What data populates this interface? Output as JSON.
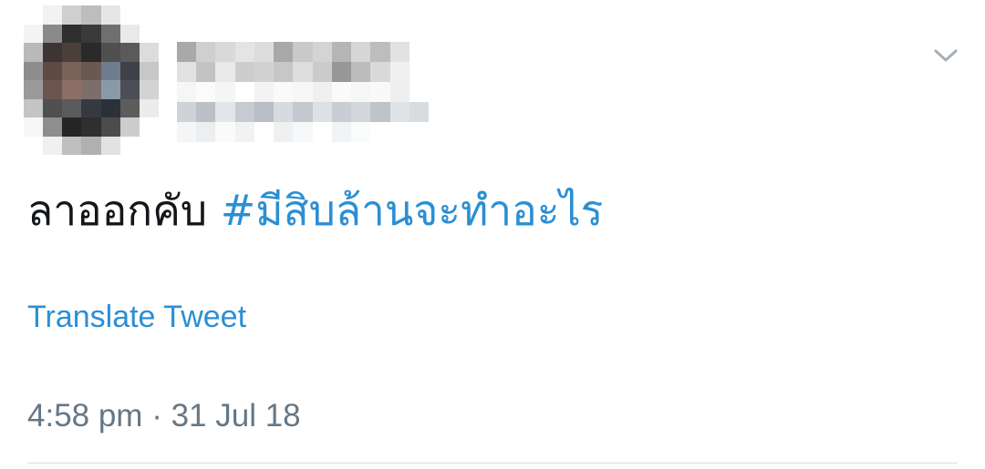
{
  "tweet": {
    "text": "ลาออกคับ ",
    "hashtag": "#มีสิบล้านจะทำอะไร",
    "translate_label": "Translate Tweet",
    "time": "4:58 pm",
    "separator": "·",
    "date": "31 Jul 18"
  },
  "icons": {
    "menu": "chevron-down-icon"
  },
  "colors": {
    "link": "#2b8fd4",
    "text": "#14171a",
    "muted": "#657786",
    "divider": "#d8dee3",
    "chevron": "#a4afb8"
  },
  "avatar_pixels": [
    "#ffffff",
    "#f2f2f2",
    "#cfcfcf",
    "#bdbdbd",
    "#e6e6e6",
    "#ffffff",
    "#ffffff",
    "#f4f4f4",
    "#8a8a8a",
    "#2e2e2e",
    "#3a3a3a",
    "#6f6f6f",
    "#e9e9e9",
    "#ffffff",
    "#b9b9b9",
    "#3d3533",
    "#4a3f3a",
    "#2a2a2a",
    "#4f4f4f",
    "#5a5a5a",
    "#dcdcdc",
    "#8d8d8d",
    "#5e4a44",
    "#7a625a",
    "#6a5852",
    "#6e7d8e",
    "#3e4147",
    "#c7c7c7",
    "#9a9a9a",
    "#6b5550",
    "#8c6f66",
    "#7d6e6b",
    "#8a99a8",
    "#4b4f55",
    "#d3d3d3",
    "#c4c4c4",
    "#4f4f4f",
    "#5b5b5b",
    "#363a40",
    "#2c3039",
    "#5d5d5d",
    "#ececec",
    "#f6f6f6",
    "#8e8e8e",
    "#252525",
    "#2f2f2f",
    "#4c4c4c",
    "#cdcdcd",
    "#ffffff",
    "#ffffff",
    "#f0f0f0",
    "#bfbfbf",
    "#b0b0b0",
    "#e2e2e2",
    "#ffffff",
    "#ffffff"
  ],
  "name_pixels": [
    "#a9a9a9",
    "#cfcfcf",
    "#d9d9d9",
    "#e4e4e4",
    "#dcdcdc",
    "#a8a8a8",
    "#c9c9c9",
    "#d4d4d4",
    "#b5b5b5",
    "#d6d6d6",
    "#bdbdbd",
    "#e2e2e2",
    "#ffffff",
    "#e1e1e1",
    "#c3c3c3",
    "#e9e9e9",
    "#cdcdcd",
    "#d2d2d2",
    "#c7c7c7",
    "#dedede",
    "#cbcbcb",
    "#979797",
    "#bcbcbc",
    "#d9d9d9",
    "#f0f0f0",
    "#ffffff",
    "#f6f6f6",
    "#fbfbfb",
    "#f5f5f5",
    "#ffffff",
    "#f3f3f3",
    "#fafafa",
    "#f7f7f7",
    "#f0f0f0",
    "#fafafa",
    "#f6f6f6",
    "#f9f9f9",
    "#efefef",
    "#ffffff",
    "#cfd2d6",
    "#bcc1c7",
    "#e3e5e8",
    "#c6cbd1",
    "#b8bec5",
    "#d7dbe0",
    "#c4c9cf",
    "#dde0e4",
    "#c9ced4",
    "#d3d7dc",
    "#bfc4ca",
    "#e0e3e6",
    "#d9dcdf",
    "#f4f5f6",
    "#eceef0",
    "#fafafa",
    "#f1f2f4",
    "#ffffff",
    "#eef0f2",
    "#f7f8f9",
    "#ffffff",
    "#f2f3f5",
    "#fafbfb",
    "#ffffff",
    "#ffffff",
    "#ffffff"
  ]
}
